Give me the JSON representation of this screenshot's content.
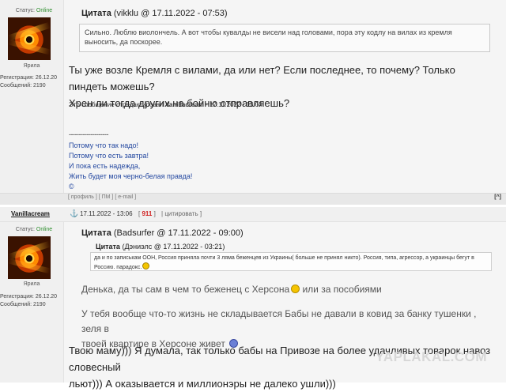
{
  "post1": {
    "user": {
      "status_label": "Статус:",
      "status_value": "Online",
      "caption": "Ярила",
      "reg_label": "Регистрация:",
      "reg_date": "26.12.20",
      "msgs_label": "Сообщений:",
      "msgs_count": "2190"
    },
    "quote": {
      "label": "Цитата",
      "meta": "(vikklu @ 17.11.2022 - 07:53)",
      "text": "Сильно. Люблю виолончель. А вот чтобы кувалды не висели над головами, пора эту кодлу на вилах из кремля выносить, да поскорее."
    },
    "body_lines": [
      "Ты уже возле Кремля с вилами, да или нет? Если последнее, то почему? Только пиндеть можешь?",
      "Хрен ли тогда других на бойню отправляешь?"
    ],
    "edit_note_prefix": "Это сообщение отредактировал ",
    "edit_note_user": "Vanillacream",
    "edit_note_suffix": " - 17.11.2022 - 13:04",
    "sig_rule": "--------------------",
    "signature": [
      "Потому что так надо!",
      "Потому что есть завтра!",
      "И пока есть надежда,",
      "Жить будет моя черно-белая правда!",
      "©"
    ],
    "footer": {
      "profile": "профиль",
      "pm": "ПМ",
      "email": "e-mail",
      "top": "[^]"
    }
  },
  "post2": {
    "author": "Vanillacream",
    "anchor": "⚓",
    "date": "17.11.2022 - 13:06",
    "rating": "911",
    "quote_link": "цитировать",
    "user": {
      "status_label": "Статус:",
      "status_value": "Online",
      "caption": "Ярила",
      "reg_label": "Регистрация:",
      "reg_date": "26.12.20",
      "msgs_label": "Сообщений:",
      "msgs_count": "2190"
    },
    "quote": {
      "label": "Цитата",
      "meta": "(Badsurfer @ 17.11.2022 - 09:00)",
      "inner_label": "Цитата",
      "inner_meta": "(Дэниэлс @ 17.11.2022 - 03:21)",
      "inner_text_a": "да и по записькам ООН, Россия приняла почти 3 ляма беженцев из Украины( больше не принял никто). Россия, типа, агрессор, а украинцы бегут в Россию. парадокс.",
      "line1": "Денька, да ты сам в чем то беженец с Херсона",
      "line1b": " или за пособиями",
      "line2": "У тебя вообще что-то жизнь не складывается Бабы не давали в ковид за банку тушенки , зеля в",
      "line3": "твоей квартире в Херсоне живет"
    },
    "body_lines": [
      "Твою маму))) Я думала, так только бабы на Привозе на более удачливых товарок навоз словесный",
      "льют))) А оказывается и миллионэры не далеко ушли)))"
    ]
  },
  "watermark": "YAPLAKAL.COM"
}
